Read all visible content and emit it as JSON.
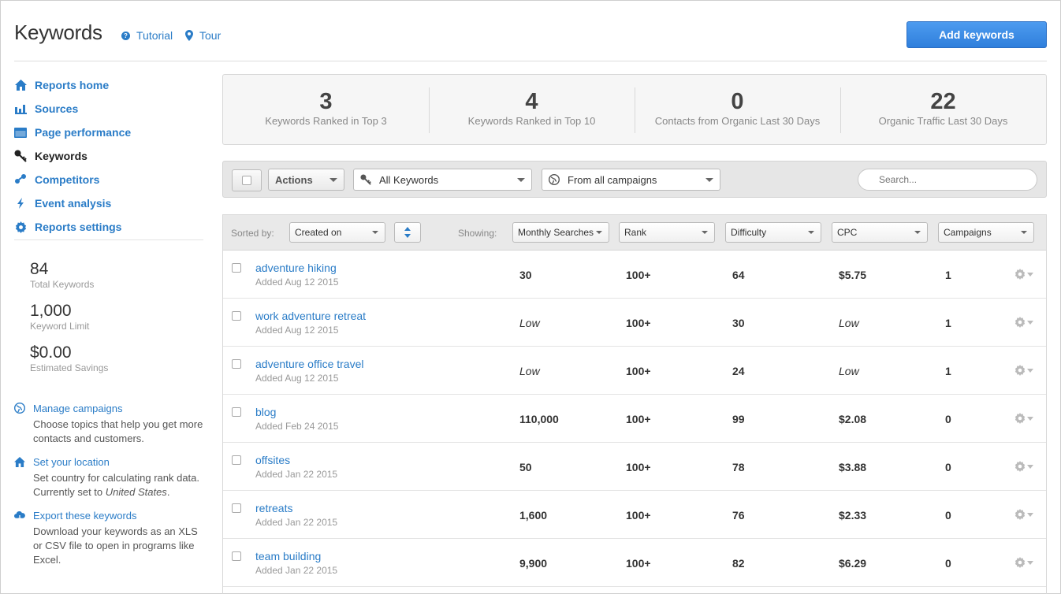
{
  "header": {
    "title": "Keywords",
    "tutorial_label": "Tutorial",
    "tour_label": "Tour",
    "add_button": "Add keywords"
  },
  "sidebar": {
    "nav": [
      {
        "label": "Reports home",
        "icon": "home-icon"
      },
      {
        "label": "Sources",
        "icon": "bar-chart-icon"
      },
      {
        "label": "Page performance",
        "icon": "browser-icon"
      },
      {
        "label": "Keywords",
        "icon": "key-icon",
        "active": true
      },
      {
        "label": "Competitors",
        "icon": "competitors-icon"
      },
      {
        "label": "Event analysis",
        "icon": "lightning-icon"
      },
      {
        "label": "Reports settings",
        "icon": "gear-icon"
      }
    ],
    "stats": [
      {
        "value": "84",
        "label": "Total Keywords"
      },
      {
        "value": "1,000",
        "label": "Keyword Limit"
      },
      {
        "value": "$0.00",
        "label": "Estimated Savings"
      }
    ],
    "help": [
      {
        "title": "Manage campaigns",
        "body": "Choose topics that help you get more contacts and customers."
      },
      {
        "title": "Set your location",
        "body_prefix": "Set country for calculating rank data. Currently set to ",
        "body_italic": "United States",
        "body_suffix": "."
      },
      {
        "title": "Export these keywords",
        "body": "Download your keywords as an XLS or CSV file to open in programs like Excel."
      }
    ]
  },
  "summary": [
    {
      "value": "3",
      "label": "Keywords Ranked in Top 3"
    },
    {
      "value": "4",
      "label": "Keywords Ranked in Top 10"
    },
    {
      "value": "0",
      "label": "Contacts from Organic Last 30 Days"
    },
    {
      "value": "22",
      "label": "Organic Traffic Last 30 Days"
    }
  ],
  "filters": {
    "actions": "Actions",
    "keywords_filter": "All Keywords",
    "campaign_filter": "From all campaigns",
    "search_placeholder": "Search..."
  },
  "table": {
    "sorted_by_label": "Sorted by:",
    "sort_value": "Created on",
    "showing_label": "Showing:",
    "columns": [
      "Monthly Searches",
      "Rank",
      "Difficulty",
      "CPC",
      "Campaigns"
    ],
    "rows": [
      {
        "keyword": "adventure hiking",
        "added": "Added Aug 12 2015",
        "searches": "30",
        "rank": "100+",
        "difficulty": "64",
        "cpc": "$5.75",
        "campaigns": "1"
      },
      {
        "keyword": "work adventure retreat",
        "added": "Added Aug 12 2015",
        "searches": "Low",
        "rank": "100+",
        "difficulty": "30",
        "cpc": "Low",
        "campaigns": "1"
      },
      {
        "keyword": "adventure office travel",
        "added": "Added Aug 12 2015",
        "searches": "Low",
        "rank": "100+",
        "difficulty": "24",
        "cpc": "Low",
        "campaigns": "1"
      },
      {
        "keyword": "blog",
        "added": "Added Feb 24 2015",
        "searches": "110,000",
        "rank": "100+",
        "difficulty": "99",
        "cpc": "$2.08",
        "campaigns": "0"
      },
      {
        "keyword": "offsites",
        "added": "Added Jan 22 2015",
        "searches": "50",
        "rank": "100+",
        "difficulty": "78",
        "cpc": "$3.88",
        "campaigns": "0"
      },
      {
        "keyword": "retreats",
        "added": "Added Jan 22 2015",
        "searches": "1,600",
        "rank": "100+",
        "difficulty": "76",
        "cpc": "$2.33",
        "campaigns": "0"
      },
      {
        "keyword": "team building",
        "added": "Added Jan 22 2015",
        "searches": "9,900",
        "rank": "100+",
        "difficulty": "82",
        "cpc": "$6.29",
        "campaigns": "0"
      }
    ]
  }
}
